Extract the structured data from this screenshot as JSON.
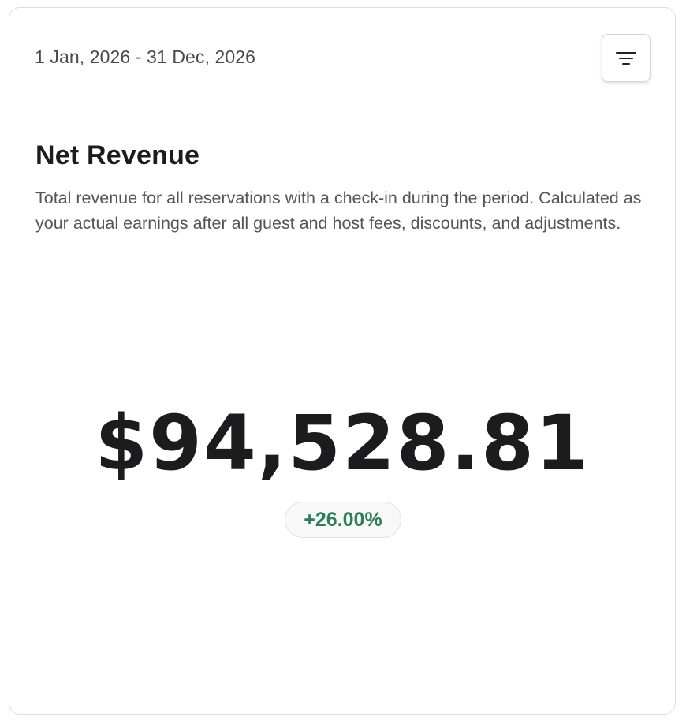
{
  "header": {
    "date_range": "1 Jan, 2026 - 31 Dec, 2026",
    "filter_icon": "filter-lines-icon"
  },
  "metric": {
    "title": "Net Revenue",
    "description": "Total revenue for all reservations with a check-in during the period. Calculated as your actual earnings after all guest and host fees, discounts, and adjustments.",
    "value": "$94,528.81",
    "change": "+26.00%",
    "change_color": "#2e7d5b"
  }
}
